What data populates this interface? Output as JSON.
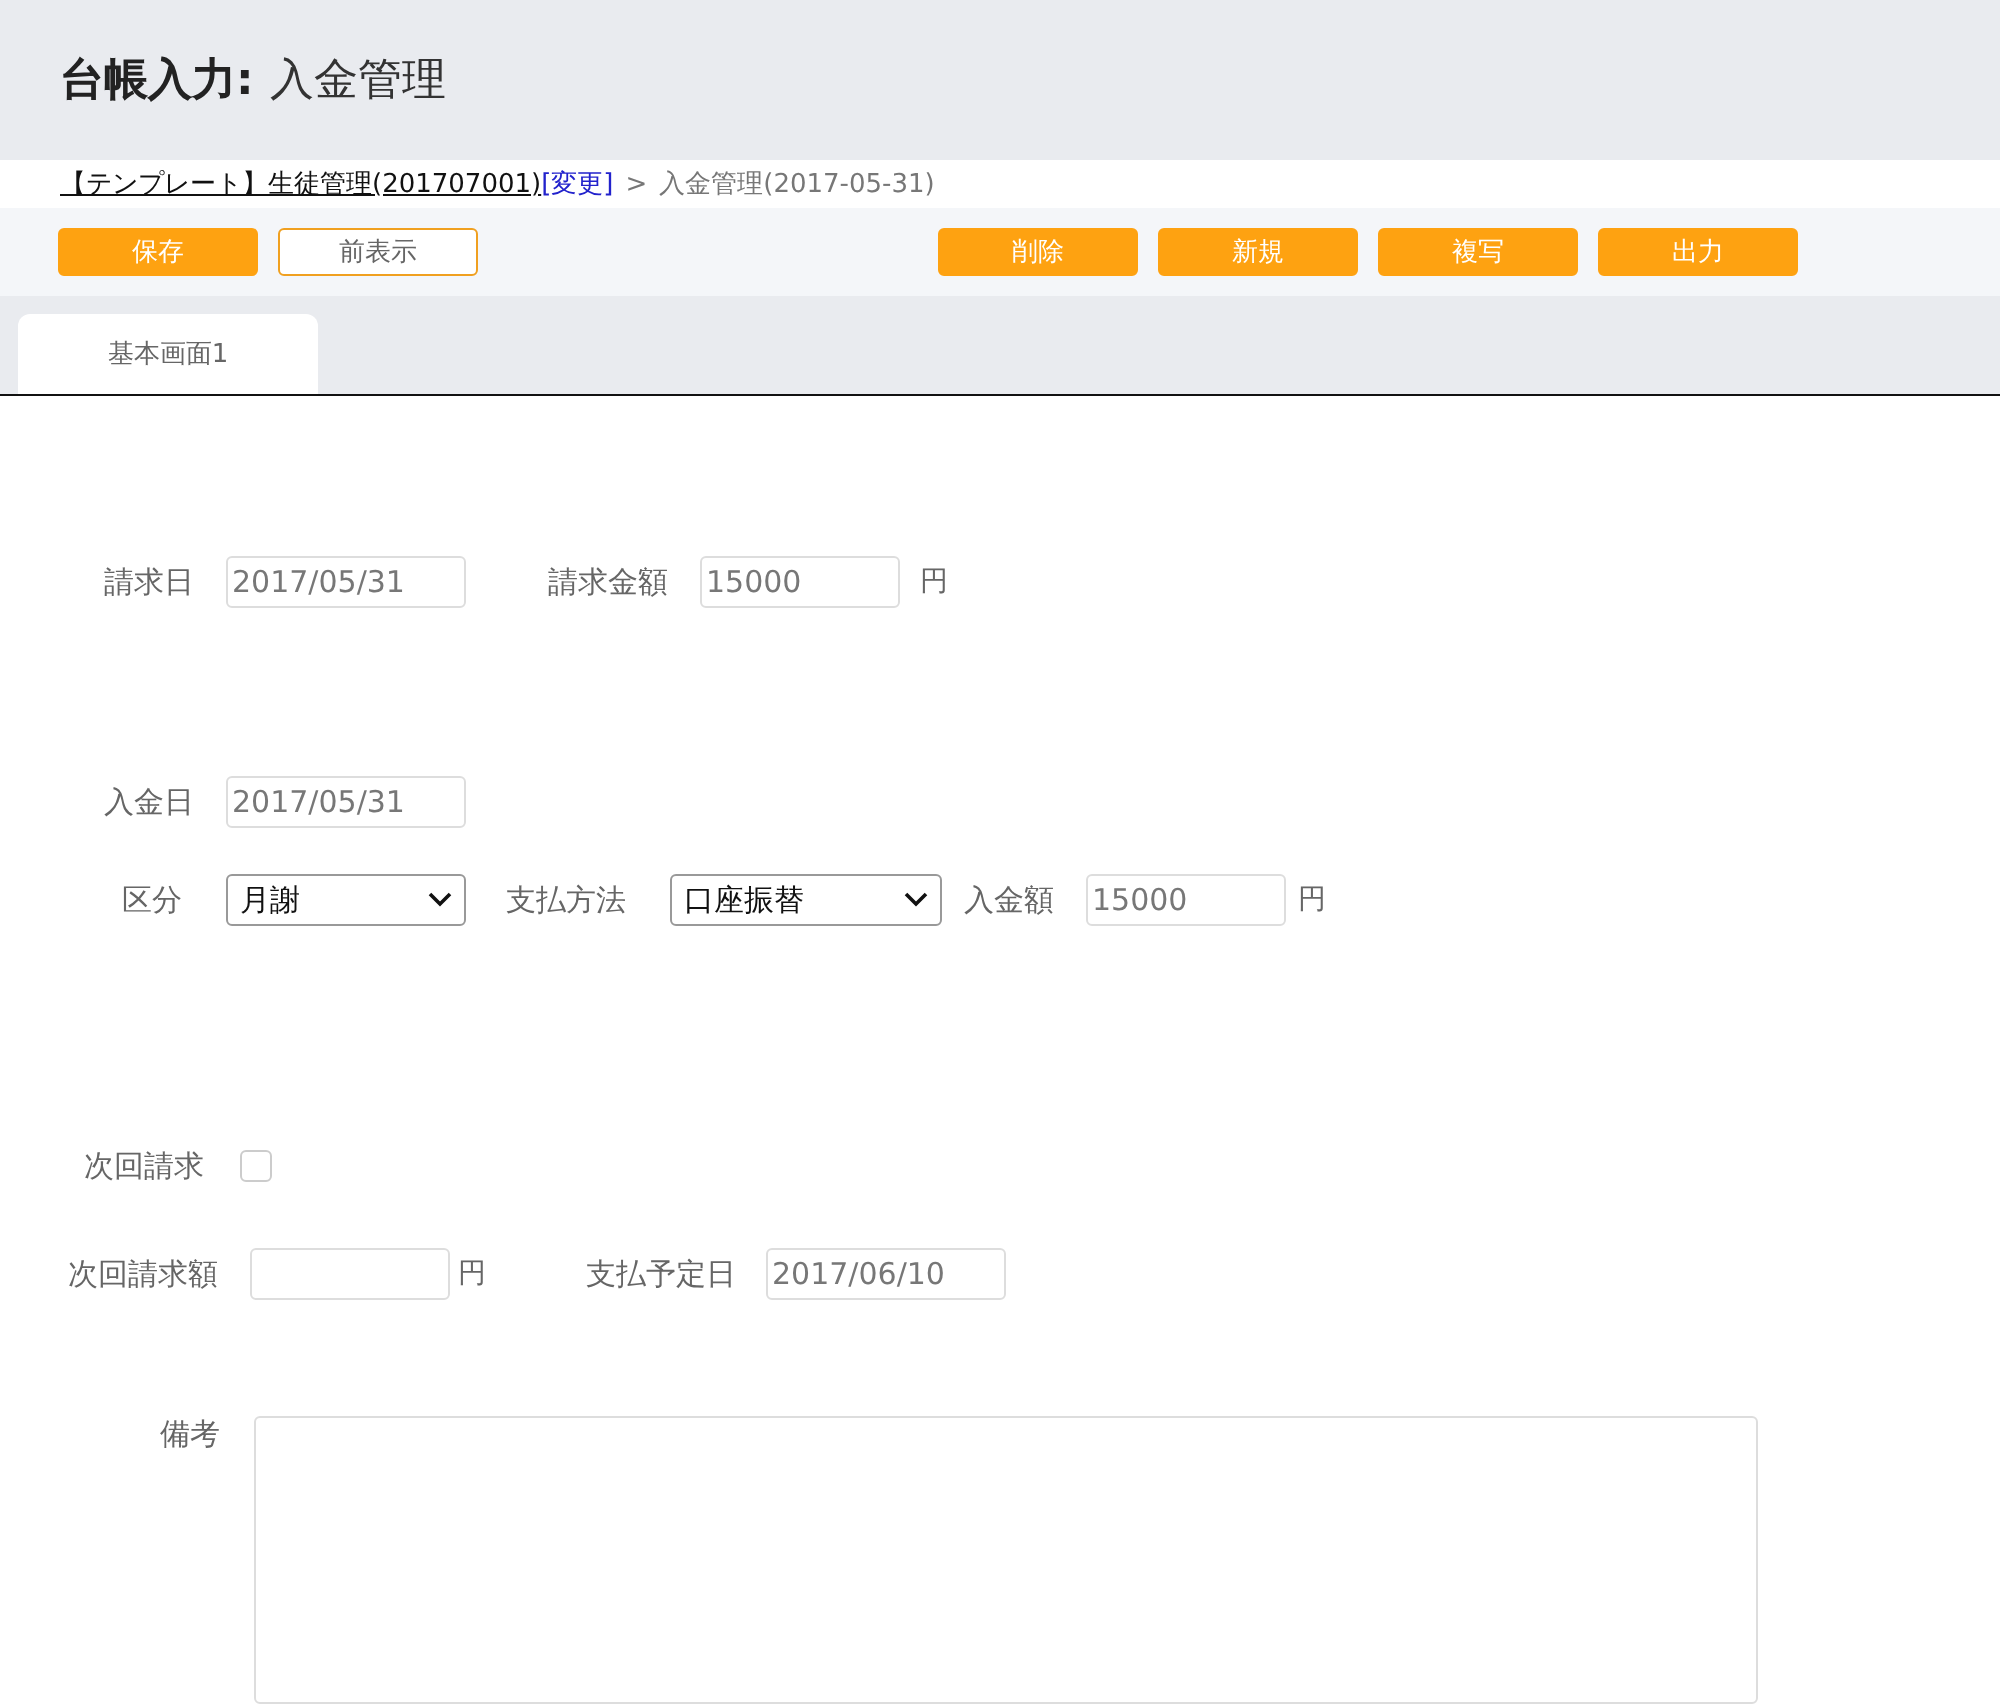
{
  "header": {
    "title_bold": "台帳入力:",
    "title": "入金管理"
  },
  "breadcrumb": {
    "link": "【テンプレート】生徒管理(201707001)",
    "change_link": "[変更]",
    "separator": ">",
    "current": "入金管理(2017-05-31)"
  },
  "toolbar": {
    "left_buttons": [
      {
        "label": "保存",
        "kind": "primary"
      },
      {
        "label": "前表示",
        "kind": "outline"
      }
    ],
    "right_buttons": [
      {
        "label": "削除"
      },
      {
        "label": "新規"
      },
      {
        "label": "複写"
      },
      {
        "label": "出力"
      }
    ]
  },
  "tabs": [
    {
      "label": "基本画面1",
      "selected": true
    }
  ],
  "form": {
    "billing_date": {
      "label": "請求日",
      "value": "2017/05/31"
    },
    "billing_amount": {
      "label": "請求金額",
      "value": "15000",
      "unit": "円"
    },
    "payment_date": {
      "label": "入金日",
      "value": "2017/05/31"
    },
    "category": {
      "label": "区分",
      "value": "月謝"
    },
    "payment_method": {
      "label": "支払方法",
      "value": "口座振替"
    },
    "payment_amount": {
      "label": "入金額",
      "value": "15000",
      "unit": "円"
    },
    "next_billing": {
      "label": "次回請求",
      "checked": false
    },
    "next_billing_amount": {
      "label": "次回請求額",
      "unit": "円"
    },
    "scheduled_payment_date": {
      "label": "支払予定日",
      "value": "2017/06/10"
    },
    "remarks": {
      "label": "備考"
    }
  }
}
